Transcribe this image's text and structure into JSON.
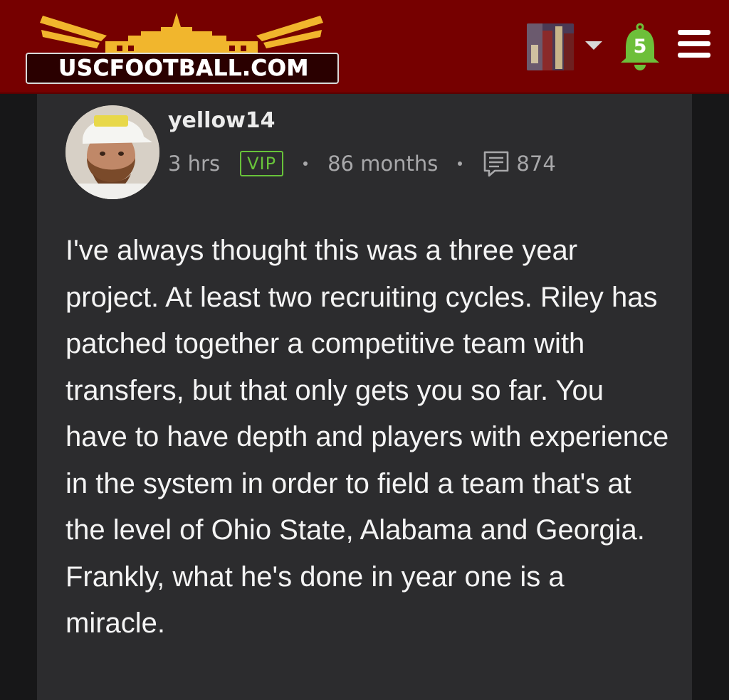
{
  "header": {
    "logo_text": "USCFOOTBALL.COM",
    "notification_count": "5",
    "colors": {
      "bar": "#760000",
      "logo_gold": "#f1b62d",
      "bell": "#6dbf3a"
    },
    "icons": [
      "user-avatar-thumbnail",
      "chevron-down-icon",
      "bell-icon",
      "menu-icon"
    ]
  },
  "post": {
    "username": "yellow14",
    "time_ago": "3 hrs",
    "badge": "VIP",
    "tenure": "86 months",
    "post_count": "874",
    "body": "I've always thought this was a three year project. At least two recruiting cycles. Riley has patched together a competitive team with transfers, but that only gets you so far. You have to have depth and players with experience in the system in order to field a team that's at the level of Ohio State, Alabama and Georgia. Frankly, what he's done in year one is a miracle.",
    "colors": {
      "card": "#2c2c2e",
      "vip": "#68c33a",
      "meta": "#a8a8aa"
    }
  }
}
